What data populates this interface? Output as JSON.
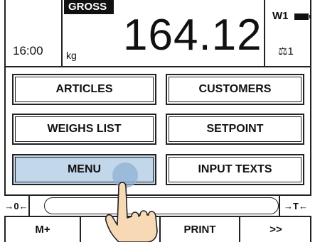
{
  "header": {
    "time": "16:00",
    "mode_badge": "GROSS",
    "unit": "kg",
    "weight": "164.12",
    "channel": "W1",
    "scale_label": "⚖1",
    "battery_icon": "battery-full-icon"
  },
  "buttons": {
    "articles": "ARTICLES",
    "customers": "CUSTOMERS",
    "weighs_list": "WEIGHS LIST",
    "setpoint": "SETPOINT",
    "menu": "MENU",
    "input_texts": "INPUT TEXTS"
  },
  "tare_bar": {
    "zero": "→0←",
    "tare": "→T←"
  },
  "softkeys": {
    "mplus": "M+",
    "second": "",
    "print": "PRINT",
    "next": ">>"
  },
  "colors": {
    "active_button": "#c3d7ea",
    "border": "#222222"
  }
}
